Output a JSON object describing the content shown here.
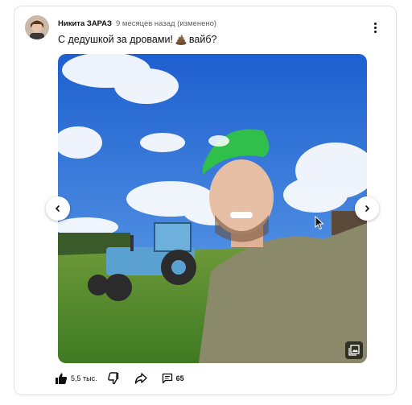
{
  "post": {
    "author": "Никита ЗАРАЗ",
    "time": "9 месяцев назад (изменено)",
    "text": "С дедушкой за дровами!",
    "text_suffix": "вайб?",
    "emoji_icon": "poop-emoji-icon"
  },
  "media": {
    "image_icon": "photo-selfie-tractor",
    "gallery_icon": "image-gallery-icon"
  },
  "actions": {
    "like_count": "5,5 тыс.",
    "comment_count": "65"
  },
  "colors": {
    "sky": "#2f6fd6",
    "grass": "#5a8a2e",
    "tractor": "#5aa0d0",
    "cap": "#2fbf4a",
    "hoodie": "#8a8a6a"
  }
}
